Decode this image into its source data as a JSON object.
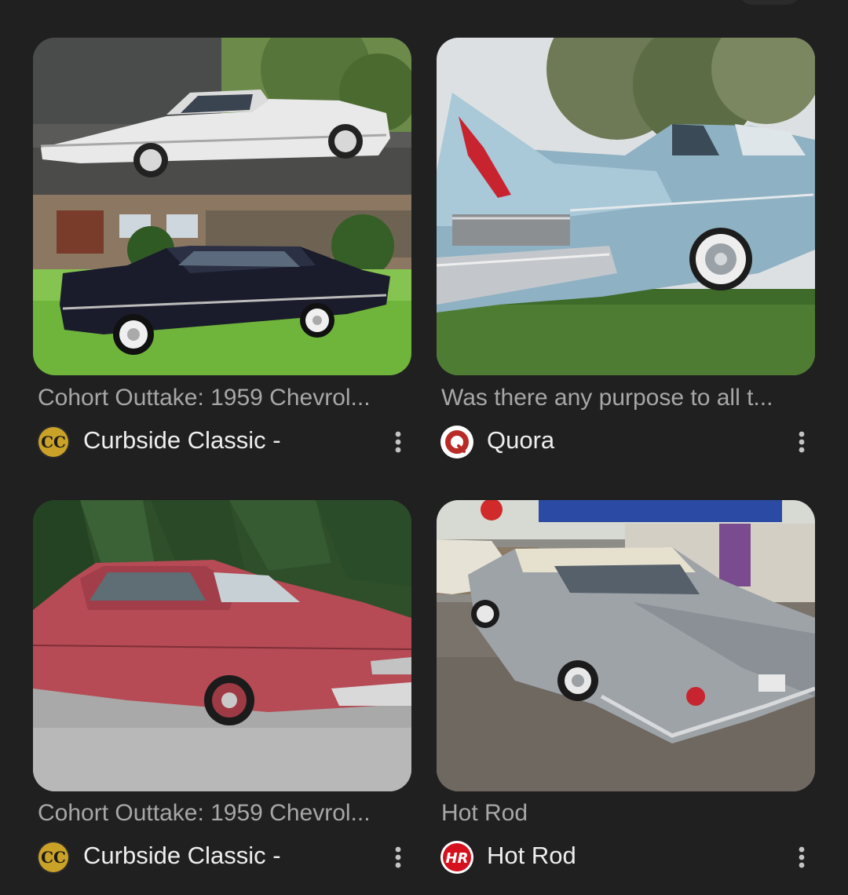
{
  "results": [
    {
      "title": "Cohort Outtake: 1959 Chevrol...",
      "source": "Curbside Classic -",
      "favicon": "curbside-classic-logo-icon",
      "favicon_text": "CC"
    },
    {
      "title": "Was there any purpose to all t...",
      "source": "Quora",
      "favicon": "quora-logo-icon"
    },
    {
      "title": "Cohort Outtake: 1959 Chevrol...",
      "source": "Curbside Classic -",
      "favicon": "curbside-classic-logo-icon",
      "favicon_text": "CC"
    },
    {
      "title": "Hot Rod",
      "source": "Hot Rod",
      "favicon": "hot-rod-logo-icon",
      "favicon_text": "HR"
    }
  ],
  "colors": {
    "background": "#202020",
    "title_text": "#a7a7a7",
    "source_text": "#eeeeee",
    "quora_red": "#b92b27",
    "hotrod_red": "#d6111e",
    "cc_gold": "#c9a227"
  },
  "icons": {
    "more": "more-vert-icon"
  }
}
